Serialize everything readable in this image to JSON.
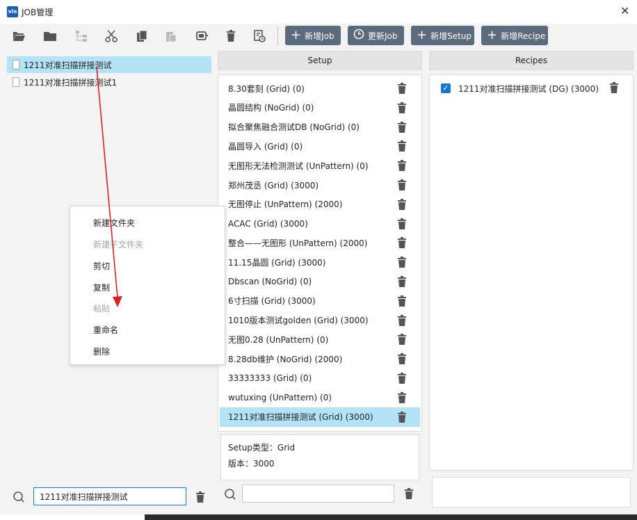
{
  "window": {
    "logo_text": "vis",
    "title": "JOB管理",
    "close_glyph": "✕"
  },
  "toolbar": {
    "icons": [
      "folder-open-icon",
      "folder-icon",
      "tree-icon",
      "cut-icon",
      "copy-icon",
      "paste-icon",
      "import-icon",
      "delete-icon",
      "refresh-config-icon"
    ],
    "buttons": [
      {
        "label": "新增Job",
        "icon": "plus-icon"
      },
      {
        "label": "更新Job",
        "icon": "clock-icon"
      },
      {
        "label": "新增Setup",
        "icon": "plus-icon"
      },
      {
        "label": "新增Recipe",
        "icon": "plus-icon"
      }
    ]
  },
  "tree": {
    "items": [
      {
        "label": "1211对准扫描拼接测试",
        "selected": true
      },
      {
        "label": "1211对准扫描拼接测试1",
        "selected": false
      }
    ]
  },
  "context_menu": {
    "items": [
      {
        "label": "新建文件夹",
        "enabled": true
      },
      {
        "label": "新建子文件夹",
        "enabled": false
      },
      {
        "label": "剪切",
        "enabled": true
      },
      {
        "label": "复制",
        "enabled": true
      },
      {
        "label": "粘贴",
        "enabled": false
      },
      {
        "label": "重命名",
        "enabled": true
      },
      {
        "label": "删除",
        "enabled": true
      }
    ]
  },
  "setup": {
    "header": "Setup",
    "items": [
      "8.30套刻 (Grid) (0)",
      "晶圆结构 (NoGrid) (0)",
      "拟合聚焦融合测试DB (NoGrid) (0)",
      "晶圆导入 (Grid) (0)",
      "无图形无法检测测试 (UnPattern) (0)",
      "郑州茂丞 (Grid) (3000)",
      "无图停止 (UnPattern) (2000)",
      "ACAC (Grid) (3000)",
      "整合——无图形 (UnPattern) (2000)",
      "11.15晶圆 (Grid) (3000)",
      "Dbscan (NoGrid) (0)",
      "6寸扫描 (Grid) (3000)",
      "1010版本测试golden (Grid) (3000)",
      "无图0.28 (UnPattern) (0)",
      "8.28db维护 (NoGrid) (2000)",
      "33333333 (Grid) (0)",
      "wutuxing (UnPattern) (0)",
      "1211对准扫描拼接测试 (Grid) (3000)"
    ],
    "selected_index": 17,
    "detail": {
      "type_line": "Setup类型：Grid",
      "version_line": "版本：3000"
    },
    "search_value": ""
  },
  "recipes": {
    "header": "Recipes",
    "items": [
      {
        "label": "1211对准扫描拼接测试 (DG) (3000)",
        "checked": true
      }
    ]
  },
  "job_search": {
    "value": "1211对准扫描拼接测试"
  },
  "colors": {
    "accent": "#1976d2",
    "selection": "#b3e3f7",
    "button_bg": "#5b6b7d",
    "annotation_arrow": "#e02020"
  }
}
